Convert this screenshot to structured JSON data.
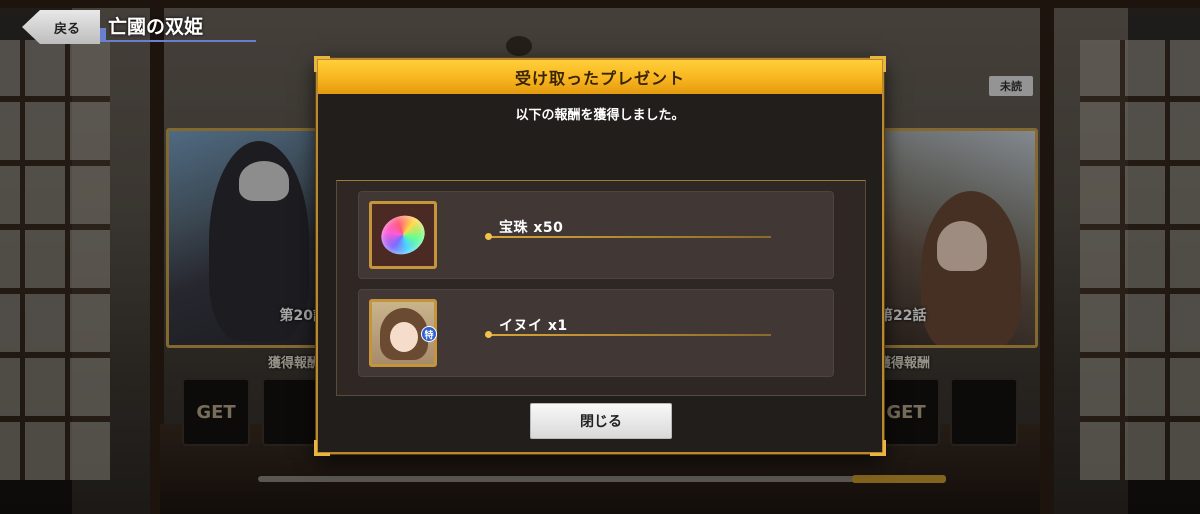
{
  "header": {
    "back_label": "戻る",
    "story_title": "亡國の双姫"
  },
  "background": {
    "unread_badge": "未読",
    "episodes": [
      {
        "label": "第20話",
        "reward_caption": "獲得報酬",
        "get_label": "GET"
      },
      {
        "label": "第22話",
        "reward_caption": "獲得報酬",
        "get_label": "GET"
      }
    ]
  },
  "modal": {
    "title": "受け取ったプレゼント",
    "message": "以下の報酬を獲得しました。",
    "rewards": [
      {
        "name": "宝珠 x50",
        "icon": "rainbow-gem-icon"
      },
      {
        "name": "イヌイ x1",
        "icon": "character-portrait-icon",
        "badge": "特"
      }
    ],
    "close_label": "閉じる"
  },
  "colors": {
    "header_gold": "#f7b51f",
    "frame_gold": "#b8892e",
    "badge_blue": "#2f5fd1",
    "title_underline": "#6a7fd0"
  }
}
